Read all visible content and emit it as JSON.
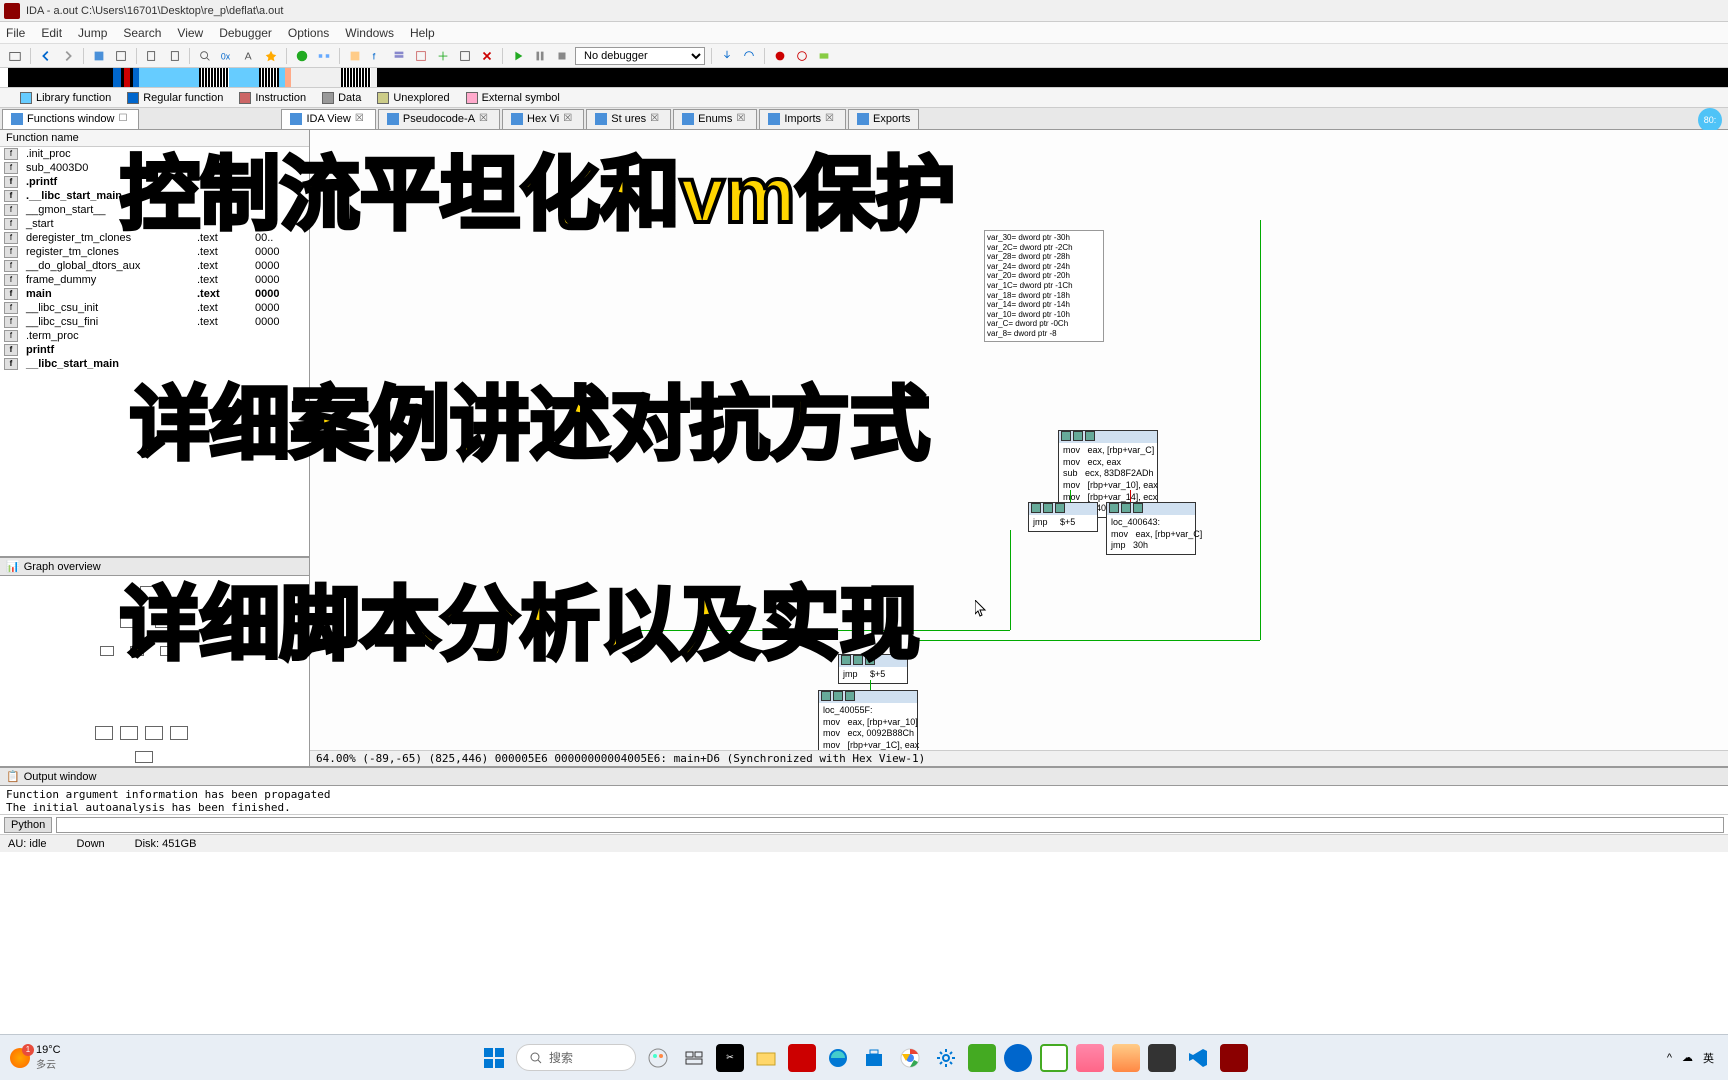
{
  "titlebar": {
    "title": "IDA - a.out C:\\Users\\16701\\Desktop\\re_p\\deflat\\a.out"
  },
  "menu": {
    "file": "File",
    "edit": "Edit",
    "jump": "Jump",
    "search": "Search",
    "view": "View",
    "debugger": "Debugger",
    "options": "Options",
    "windows": "Windows",
    "help": "Help"
  },
  "toolbar": {
    "debugger": "No debugger"
  },
  "legend": {
    "lib": "Library function",
    "reg": "Regular function",
    "ins": "Instruction",
    "data": "Data",
    "unexp": "Unexplored",
    "ext": "External symbol"
  },
  "tabs": {
    "functions": "Functions window",
    "idaview": "IDA View",
    "pseudo": "Pseudocode-A",
    "hexview": "Hex Vi",
    "structures": "St        ures",
    "enums": "Enums",
    "imports": "Imports",
    "exports": "Exports",
    "badge": "80:"
  },
  "functions": {
    "header": "Function name",
    "items": [
      {
        "name": ".init_proc",
        "seg": "",
        "off": "",
        "bold": false
      },
      {
        "name": "sub_4003D0",
        "seg": "",
        "off": "",
        "bold": false
      },
      {
        "name": ".printf",
        "seg": "",
        "off": "",
        "bold": true
      },
      {
        "name": ".__libc_start_main",
        "seg": "",
        "off": "",
        "bold": true
      },
      {
        "name": "__gmon_start__",
        "seg": "",
        "off": "",
        "bold": false
      },
      {
        "name": "_start",
        "seg": "",
        "off": "",
        "bold": false
      },
      {
        "name": "deregister_tm_clones",
        "seg": ".text",
        "off": "00..",
        "bold": false
      },
      {
        "name": "register_tm_clones",
        "seg": ".text",
        "off": "0000",
        "bold": false
      },
      {
        "name": "__do_global_dtors_aux",
        "seg": ".text",
        "off": "0000",
        "bold": false
      },
      {
        "name": "frame_dummy",
        "seg": ".text",
        "off": "0000",
        "bold": false
      },
      {
        "name": "main",
        "seg": ".text",
        "off": "0000",
        "bold": true
      },
      {
        "name": "__libc_csu_init",
        "seg": ".text",
        "off": "0000",
        "bold": false
      },
      {
        "name": "__libc_csu_fini",
        "seg": ".text",
        "off": "0000",
        "bold": false
      },
      {
        "name": ".term_proc",
        "seg": "",
        "off": "",
        "bold": false
      },
      {
        "name": "printf",
        "seg": "",
        "off": "",
        "bold": true
      },
      {
        "name": "__libc_start_main",
        "seg": "",
        "off": "",
        "bold": true
      }
    ]
  },
  "graph_overview": {
    "title": "Graph overview"
  },
  "vars": [
    "var_30= dword ptr -30h",
    "var_2C= dword ptr -2Ch",
    "var_28= dword ptr -28h",
    "var_24= dword ptr -24h",
    "var_20= dword ptr -20h",
    "var_1C= dword ptr -1Ch",
    "var_18= dword ptr -18h",
    "var_14= dword ptr -14h",
    "var_10= dword ptr -10h",
    "var_C= dword ptr -0Ch",
    "var_8= dword ptr -8"
  ],
  "nodes": {
    "n1": "mov   eax, [rbp+var_C]\nmov   ecx, eax\nsub   ecx, 83D8F2ADh\nmov   [rbp+var_10], eax\nmov   [rbp+var_14], ecx\njz    loc_400643",
    "n2": "jmp     $+5",
    "n3": "loc_400643:\nmov   eax, [rbp+var_C]\njmp   30h",
    "n4": "jmp     $+5",
    "n5": "loc_40055F:\nmov   eax, [rbp+var_10]\nmov   ecx, 0092B88Ch\nmov   [rbp+var_1C], eax"
  },
  "graph_status": "64.00% (-89,-65) (825,446) 000005E6 00000000004005E6: main+D6 (Synchronized with Hex View-1)",
  "output": {
    "title": "Output window",
    "lines": "Function argument information has been propagated\nThe initial autoanalysis has been finished.",
    "python": "Python"
  },
  "statusbar": {
    "au": "AU:  idle",
    "down": "Down",
    "disk": "Disk: 451GB"
  },
  "overlay": {
    "l1": "控制流平坦化和vm保护",
    "l2": "详细案例讲述对抗方式",
    "l3": "详细脚本分析以及实现"
  },
  "taskbar": {
    "temp": "19°C",
    "cond": "多云",
    "search": "搜索",
    "lang": "英"
  }
}
